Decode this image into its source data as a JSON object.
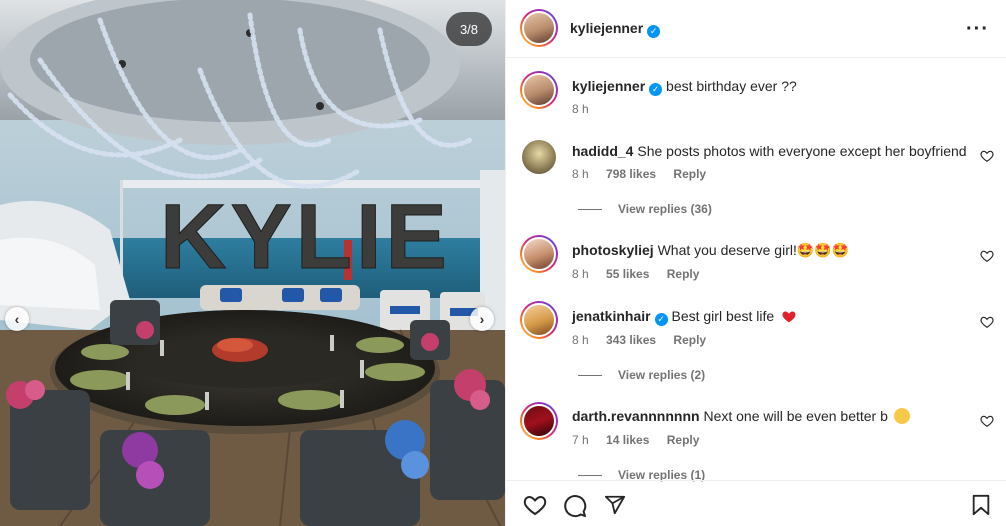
{
  "photo": {
    "counter": "3/8",
    "balloon_text": "KYLIE"
  },
  "post": {
    "author": "kyliejenner",
    "caption": "best birthday ever ??",
    "time": "8 h"
  },
  "comments": [
    {
      "user": "hadidd_4",
      "text": "She posts photos with everyone except her boyfriend",
      "time": "8 h",
      "likes": "798 likes",
      "reply": "Reply",
      "view_replies": "View replies (36)"
    },
    {
      "user": "photoskyliej",
      "text": "What you deserve girl!🤩🤩🤩",
      "time": "8 h",
      "likes": "55 likes",
      "reply": "Reply"
    },
    {
      "user": "jenatkinhair",
      "text": "Best girl best life",
      "time": "8 h",
      "likes": "343 likes",
      "reply": "Reply",
      "view_replies": "View replies (2)"
    },
    {
      "user": "darth.revannnnnnn",
      "text": "Next one will be even better b",
      "time": "7 h",
      "likes": "14 likes",
      "reply": "Reply",
      "view_replies": "View replies (1)"
    }
  ],
  "colors": {
    "verified": "#0095f6",
    "heart_red": "#ed4956",
    "muted": "#737373"
  },
  "icons": [
    "more-options-icon",
    "heart-icon",
    "comment-icon",
    "share-icon",
    "bookmark-icon",
    "verified-badge-icon",
    "chevron-left-icon",
    "chevron-right-icon"
  ]
}
